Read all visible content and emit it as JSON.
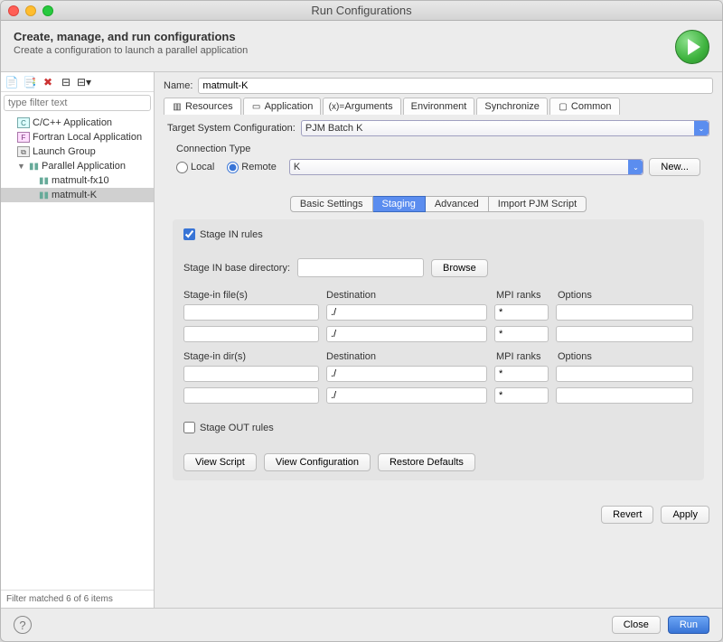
{
  "window": {
    "title": "Run Configurations"
  },
  "header": {
    "title": "Create, manage, and run configurations",
    "subtitle": "Create a configuration to launch a parallel application"
  },
  "sidebar": {
    "filter_placeholder": "type filter text",
    "items": [
      {
        "label": "C/C++ Application",
        "badge": "C"
      },
      {
        "label": "Fortran Local Application",
        "badge": "F"
      },
      {
        "label": "Launch Group",
        "badge": "G"
      },
      {
        "label": "Parallel Application",
        "expandable": true,
        "children": [
          {
            "label": "matmult-fx10"
          },
          {
            "label": "matmult-K",
            "selected": true
          }
        ]
      }
    ],
    "filter_status": "Filter matched 6 of 6 items"
  },
  "main": {
    "name_label": "Name:",
    "name_value": "matmult-K",
    "tabs": [
      "Resources",
      "Application",
      "Arguments",
      "Environment",
      "Synchronize",
      "Common"
    ],
    "target_label": "Target System Configuration:",
    "target_value": "PJM Batch K",
    "conn": {
      "legend": "Connection Type",
      "local": "Local",
      "remote": "Remote",
      "remote_value": "K",
      "new_btn": "New..."
    },
    "subtabs": [
      "Basic Settings",
      "Staging",
      "Advanced",
      "Import PJM Script"
    ],
    "stage_in_chk": "Stage IN rules",
    "stage_in_base_label": "Stage IN base directory:",
    "browse_btn": "Browse",
    "cols": {
      "files": "Stage-in file(s)",
      "dirs": "Stage-in dir(s)",
      "dest": "Destination",
      "mpi": "MPI ranks",
      "opts": "Options"
    },
    "rows_files": [
      {
        "src": "",
        "dest": "./",
        "mpi": "*",
        "opts": ""
      },
      {
        "src": "",
        "dest": "./",
        "mpi": "*",
        "opts": ""
      }
    ],
    "rows_dirs": [
      {
        "src": "",
        "dest": "./",
        "mpi": "*",
        "opts": ""
      },
      {
        "src": "",
        "dest": "./",
        "mpi": "*",
        "opts": ""
      }
    ],
    "stage_out_chk": "Stage OUT rules",
    "view_script": "View Script",
    "view_config": "View Configuration",
    "restore_defaults": "Restore Defaults",
    "revert": "Revert",
    "apply": "Apply"
  },
  "footer": {
    "close": "Close",
    "run": "Run"
  }
}
